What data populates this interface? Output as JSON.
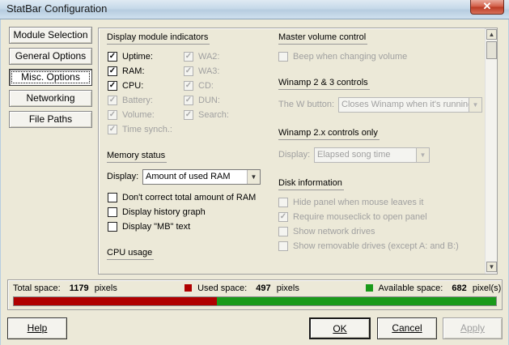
{
  "window": {
    "title": "StatBar Configuration",
    "close_glyph": "✕"
  },
  "nav": [
    {
      "label": "Module Selection"
    },
    {
      "label": "General Options"
    },
    {
      "label": "Misc. Options"
    },
    {
      "label": "Networking"
    },
    {
      "label": "File Paths"
    }
  ],
  "display_indicators": {
    "title": "Display module indicators",
    "left": [
      {
        "label": "Uptime:",
        "checked": true,
        "disabled": false
      },
      {
        "label": "RAM:",
        "checked": true,
        "disabled": false
      },
      {
        "label": "CPU:",
        "checked": true,
        "disabled": false
      },
      {
        "label": "Battery:",
        "checked": true,
        "disabled": true
      },
      {
        "label": "Volume:",
        "checked": true,
        "disabled": true
      },
      {
        "label": "Time synch.:",
        "checked": true,
        "disabled": true
      }
    ],
    "right": [
      {
        "label": "WA2:",
        "checked": true,
        "disabled": true
      },
      {
        "label": "WA3:",
        "checked": true,
        "disabled": true
      },
      {
        "label": "CD:",
        "checked": true,
        "disabled": true
      },
      {
        "label": "DUN:",
        "checked": true,
        "disabled": true
      },
      {
        "label": "Search:",
        "checked": true,
        "disabled": true
      }
    ]
  },
  "memory_status": {
    "title": "Memory status",
    "display_label": "Display:",
    "display_value": "Amount of used RAM",
    "options": [
      {
        "label": "Don't correct total amount of RAM",
        "checked": false
      },
      {
        "label": "Display history graph",
        "checked": false
      },
      {
        "label": "Display \"MB\" text",
        "checked": false
      }
    ]
  },
  "cpu_usage": {
    "title": "CPU usage"
  },
  "master_volume": {
    "title": "Master volume control",
    "beep": {
      "label": "Beep when changing volume",
      "checked": false,
      "disabled": true
    }
  },
  "winamp23": {
    "title": "Winamp 2 & 3 controls",
    "w_button_label": "The W button:",
    "w_button_value": "Closes Winamp when it's running"
  },
  "winamp2x": {
    "title": "Winamp 2.x controls only",
    "display_label": "Display:",
    "display_value": "Elapsed song time"
  },
  "disk_info": {
    "title": "Disk information",
    "options": [
      {
        "label": "Hide panel when mouse leaves it",
        "checked": false,
        "disabled": true
      },
      {
        "label": "Require mouseclick to open panel",
        "checked": true,
        "disabled": true
      },
      {
        "label": "Show network drives",
        "checked": false,
        "disabled": true
      },
      {
        "label": "Show removable drives (except A: and B:)",
        "checked": false,
        "disabled": true
      }
    ]
  },
  "status": {
    "total_label": "Total space:",
    "total_value": "1179",
    "used_label": "Used space:",
    "used_value": "497",
    "available_label": "Available space:",
    "available_value": "682",
    "unit_pixels": "pixels",
    "unit_pixels_s": "pixel(s)",
    "used_color": "#b00000",
    "available_color": "#1a9a1a",
    "used_fraction": 0.4215
  },
  "buttons": {
    "help": "Help",
    "ok": "OK",
    "cancel": "Cancel",
    "apply": "Apply"
  },
  "check_glyph": "✓"
}
